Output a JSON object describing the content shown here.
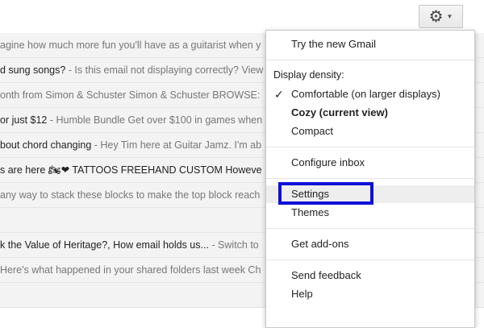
{
  "toolbar": {
    "gear_icon": "gear-icon",
    "caret_icon": "chevron-down-icon"
  },
  "emails": [
    {
      "subject": "",
      "snippet": "agine how much more fun you'll have as a guitarist when y",
      "unread": false
    },
    {
      "subject": "d sung songs?",
      "snippet": " - Is this email not displaying correctly? View",
      "unread": false
    },
    {
      "subject": "",
      "snippet": "onth from Simon & Schuster Simon & Schuster BROWSE:",
      "unread": false
    },
    {
      "subject": "or just $12",
      "snippet": " - Humble Bundle Get over $100 in games when",
      "unread": false
    },
    {
      "subject": "bout chord changing",
      "snippet": " - Hey Tim here at Guitar Jamz. I'm ab",
      "unread": false
    },
    {
      "subject": "s are here 🏍❤ TATTOOS FREEHAND CUSTOM Howeve",
      "snippet": "",
      "unread": false
    },
    {
      "subject": "",
      "snippet": "any way to stack these blocks to make the top block reach",
      "unread": false
    },
    {
      "subject": "",
      "snippet": "",
      "unread": false
    },
    {
      "subject": "k the Value of Heritage?, How email holds us...",
      "snippet": " - Switch to",
      "unread": false
    },
    {
      "subject": "",
      "snippet": "Here's what happened in your shared folders last week Ch",
      "unread": false
    },
    {
      "subject": "",
      "snippet": "",
      "unread": false
    }
  ],
  "menu": {
    "try_gmail": "Try the new Gmail",
    "density_label": "Display density:",
    "comfortable": "Comfortable (on larger displays)",
    "check_mark": "✓",
    "cozy": "Cozy (current view)",
    "compact": "Compact",
    "configure_inbox": "Configure inbox",
    "settings": "Settings",
    "themes": "Themes",
    "get_addons": "Get add-ons",
    "send_feedback": "Send feedback",
    "help": "Help"
  },
  "colors": {
    "highlight_box": "#1010d8",
    "menu_hover": "#eeeeee"
  }
}
